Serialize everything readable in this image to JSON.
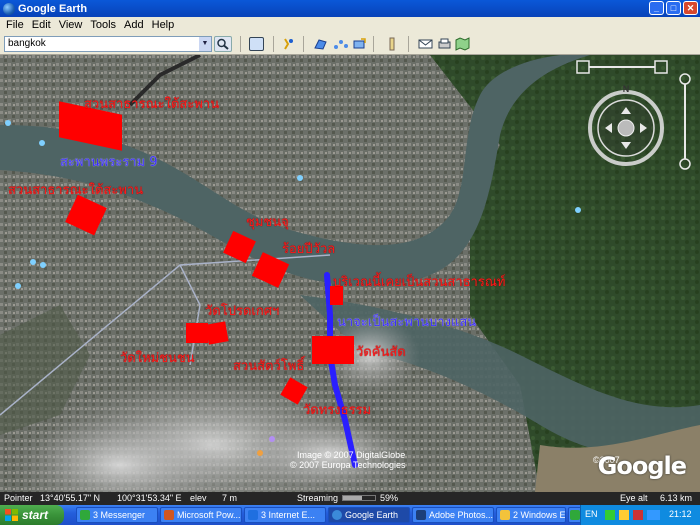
{
  "app": {
    "title": "Google Earth",
    "window_buttons": [
      "_",
      "□",
      "✕"
    ]
  },
  "menu": {
    "items": [
      "File",
      "Edit",
      "View",
      "Tools",
      "Add",
      "Help"
    ]
  },
  "search": {
    "value": "bangkok"
  },
  "map": {
    "labels": [
      {
        "text": "สวนสาธารณะใต้สะพาน",
        "color": "red"
      },
      {
        "text": "สะพานพระราม 9",
        "color": "blue"
      },
      {
        "text": "สวนสาธารณะใต้สะพาน",
        "color": "red"
      },
      {
        "text": "ชุมชนจุ",
        "color": "red"
      },
      {
        "text": "ร้อยปีวัวล",
        "color": "red"
      },
      {
        "text": "บริเวณนี้เคยเป็นสวนสาธารณท์",
        "color": "red"
      },
      {
        "text": "วัดโปรดเกศฯ",
        "color": "red"
      },
      {
        "text": "นาจะเป็นสะพานบางแสน",
        "color": "blue"
      },
      {
        "text": "วัดใหม่ชนชน",
        "color": "red"
      },
      {
        "text": "วัดคันสัด",
        "color": "red"
      },
      {
        "text": "สวนสัตว์โพธิ์",
        "color": "red"
      },
      {
        "text": "วัดทรงธรรม",
        "color": "red"
      }
    ],
    "copyright": [
      "Image © 2007 DigitalGlobe",
      "© 2007 Europa Technologies"
    ],
    "copyright_year_bottom": "©2007",
    "logo": "Google"
  },
  "status": {
    "pointer_label": "Pointer",
    "lat": "13°40'55.17\" N",
    "lon": "100°31'53.34\" E",
    "elev_label": "elev",
    "elev": "7 m",
    "streaming_label": "Streaming",
    "streaming_pct": "59%",
    "eye_alt_label": "Eye alt",
    "eye_alt": "6.13 km"
  },
  "taskbar": {
    "start_label": "start",
    "buttons": [
      {
        "label": "3 Messenger",
        "icon_color": "#2fa83a"
      },
      {
        "label": "Microsoft Pow...",
        "icon_color": "#d2561f"
      },
      {
        "label": "3 Internet E...",
        "icon_color": "#1f6fe0"
      },
      {
        "label": "Google Earth",
        "icon_color": "#3b8ad9"
      },
      {
        "label": "Adobe Photos...",
        "icon_color": "#1c3e7a"
      },
      {
        "label": "2 Windows E...",
        "icon_color": "#f3c33b"
      },
      {
        "label": "",
        "icon_color": "#2fa83a"
      }
    ],
    "lang": "EN",
    "clock": "21:12"
  },
  "colors": {
    "title_blue": "#0a58d8",
    "annotation_red": "#ff0000",
    "path_blue": "#2a1fff"
  }
}
